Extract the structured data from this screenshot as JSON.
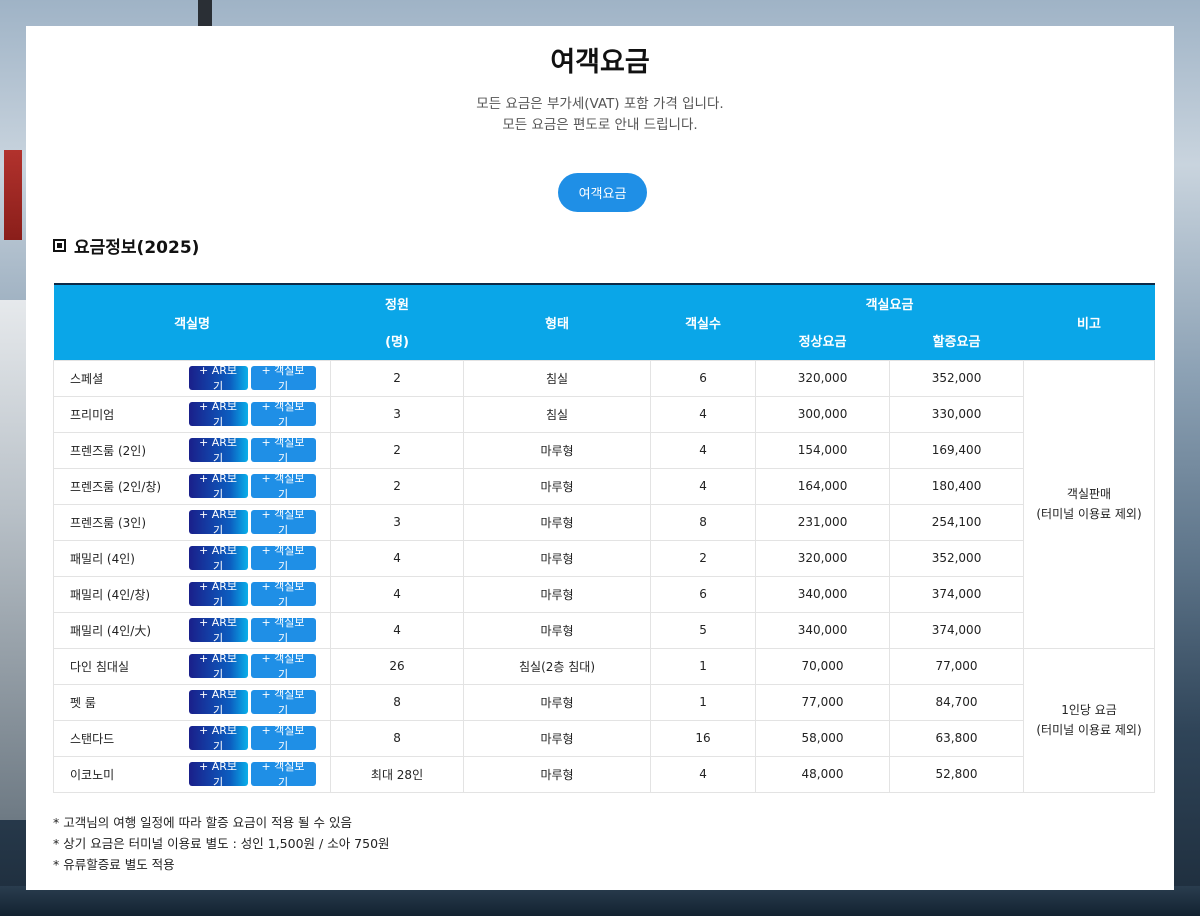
{
  "page": {
    "title": "여객요금",
    "subtitle_1": "모든 요금은 부가세(VAT) 포함 가격 입니다.",
    "subtitle_2": "모든 요금은 편도로 안내 드립니다.",
    "tab_label": "여객요금",
    "section_title": "요금정보(2025)"
  },
  "table": {
    "headers": {
      "room_name": "객실명",
      "capacity": "정원",
      "capacity_unit": "(명)",
      "type": "형태",
      "room_count": "객실수",
      "room_fare": "객실요금",
      "normal_fare": "정상요금",
      "surcharge_fare": "할증요금",
      "remarks": "비고"
    },
    "ar_button_label": "+ AR보기",
    "room_button_label": "+ 객실보기",
    "group_1": {
      "note_line_1": "객실판매",
      "note_line_2": "(터미널 이용료 제외)",
      "rows": [
        {
          "name": "스페셜",
          "capacity": "2",
          "type": "침실",
          "count": "6",
          "normal": "320,000",
          "surcharge": "352,000"
        },
        {
          "name": "프리미엄",
          "capacity": "3",
          "type": "침실",
          "count": "4",
          "normal": "300,000",
          "surcharge": "330,000"
        },
        {
          "name": "프렌즈룸 (2인)",
          "capacity": "2",
          "type": "마루형",
          "count": "4",
          "normal": "154,000",
          "surcharge": "169,400"
        },
        {
          "name": "프렌즈룸 (2인/창)",
          "capacity": "2",
          "type": "마루형",
          "count": "4",
          "normal": "164,000",
          "surcharge": "180,400"
        },
        {
          "name": "프렌즈룸 (3인)",
          "capacity": "3",
          "type": "마루형",
          "count": "8",
          "normal": "231,000",
          "surcharge": "254,100"
        },
        {
          "name": "패밀리 (4인)",
          "capacity": "4",
          "type": "마루형",
          "count": "2",
          "normal": "320,000",
          "surcharge": "352,000"
        },
        {
          "name": "패밀리 (4인/창)",
          "capacity": "4",
          "type": "마루형",
          "count": "6",
          "normal": "340,000",
          "surcharge": "374,000"
        },
        {
          "name": "패밀리 (4인/大)",
          "capacity": "4",
          "type": "마루형",
          "count": "5",
          "normal": "340,000",
          "surcharge": "374,000"
        }
      ]
    },
    "group_2": {
      "note_line_1": "1인당 요금",
      "note_line_2": "(터미널 이용료 제외)",
      "rows": [
        {
          "name": "다인 침대실",
          "capacity": "26",
          "type": "침실(2층 침대)",
          "count": "1",
          "normal": "70,000",
          "surcharge": "77,000"
        },
        {
          "name": "펫 룸",
          "capacity": "8",
          "type": "마루형",
          "count": "1",
          "normal": "77,000",
          "surcharge": "84,700"
        },
        {
          "name": "스탠다드",
          "capacity": "8",
          "type": "마루형",
          "count": "16",
          "normal": "58,000",
          "surcharge": "63,800"
        },
        {
          "name": "이코노미",
          "capacity": "최대 28인",
          "type": "마루형",
          "count": "4",
          "normal": "48,000",
          "surcharge": "52,800"
        }
      ]
    }
  },
  "footnotes": [
    "* 고객님의 여행 일정에 따라 할증 요금이 적용 될 수 있음",
    "* 상기 요금은 터미널 이용료 별도 : 성인 1,500원 / 소아 750원",
    "* 유류할증료 별도 적용"
  ]
}
